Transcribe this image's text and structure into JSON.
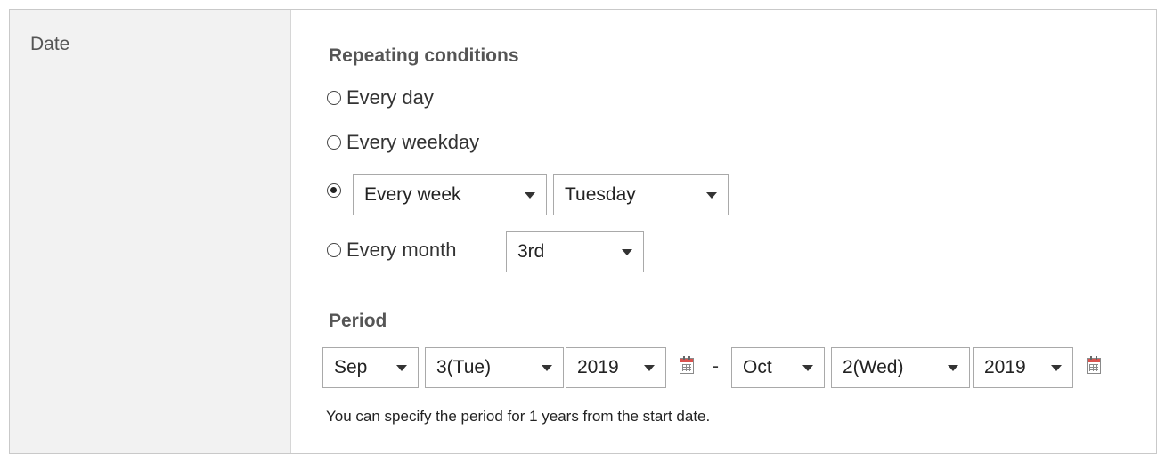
{
  "field_label": "Date",
  "repeating": {
    "title": "Repeating conditions",
    "options": [
      {
        "label": "Every day",
        "checked": false
      },
      {
        "label": "Every weekday",
        "checked": false
      },
      {
        "label": "",
        "checked": true
      },
      {
        "label": "Every month",
        "checked": false
      }
    ],
    "week_frequency": "Every week",
    "weekday": "Tuesday",
    "month_ordinal": "3rd"
  },
  "period": {
    "title": "Period",
    "start": {
      "month": "Sep",
      "day": "3(Tue)",
      "year": "2019"
    },
    "separator": "-",
    "end": {
      "month": "Oct",
      "day": "2(Wed)",
      "year": "2019"
    },
    "note": "You can specify the period for 1 years from the start date."
  },
  "icons": {
    "calendar": "calendar-icon",
    "dropdown": "chevron-down-icon"
  },
  "colors": {
    "label_bg": "#f2f2f2",
    "border": "#a9a9a9",
    "calendar_accent": "#d9534f"
  }
}
